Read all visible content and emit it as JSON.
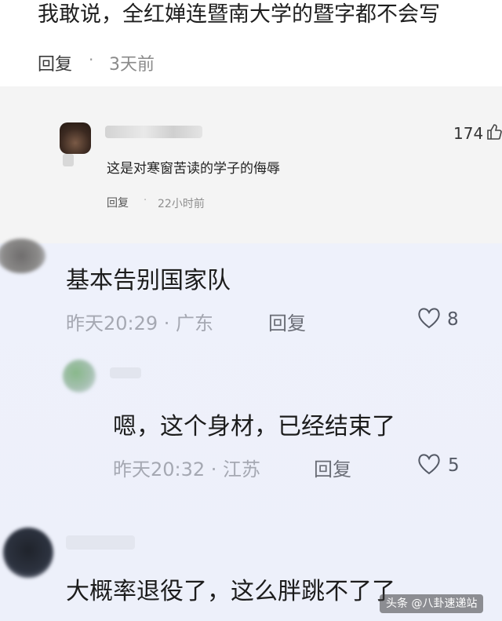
{
  "top_comment": {
    "text": "我敢说，全红婵连暨南大学的暨字都不会写",
    "reply_label": "回复",
    "separator": "·",
    "time": "3天前"
  },
  "nested_reply": {
    "text": "这是对寒窗苦读的学子的侮辱",
    "reply_label": "回复",
    "separator": "·",
    "time": "22小时前",
    "likes": "174",
    "like_icon": "thumbs-up-icon"
  },
  "comments": [
    {
      "text": "基本告别国家队",
      "time_location": "昨天20:29 · 广东",
      "reply_label": "回复",
      "likes": "8",
      "like_icon": "heart-icon"
    },
    {
      "text": "嗯，这个身材，已经结束了",
      "time_location": "昨天20:32 · 江苏",
      "reply_label": "回复",
      "likes": "5",
      "like_icon": "heart-icon"
    },
    {
      "text": "大概率退役了，这么胖跳不了了"
    }
  ],
  "watermark": {
    "text": "头条 @八卦速递站"
  },
  "colors": {
    "screenshot_bg": "#eef1fb",
    "meta_grey": "#a5a8b2",
    "band_grey": "#f4f4f4"
  }
}
